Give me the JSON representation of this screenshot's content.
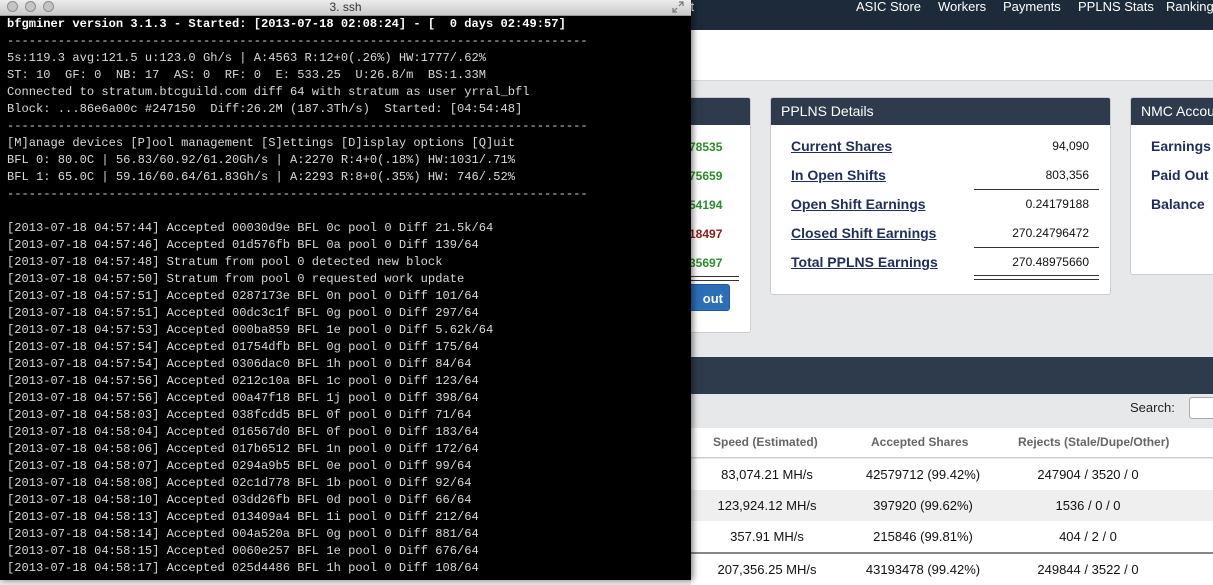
{
  "web": {
    "nav": [
      "ort",
      "ASIC Store",
      "Workers",
      "Payments",
      "PPLNS Stats",
      "Ranking"
    ],
    "left_panel": {
      "values": [
        "78535",
        "75659",
        "54194",
        "18497",
        "35697"
      ],
      "button_label": "out"
    },
    "pplns": {
      "title": "PPLNS Details",
      "rows": [
        {
          "label": "Current Shares",
          "value": "94,090"
        },
        {
          "label": "In Open Shifts",
          "value": "803,356"
        },
        {
          "label": "Open Shift Earnings",
          "value": "0.24179188"
        },
        {
          "label": "Closed Shift Earnings",
          "value": "270.24796472"
        },
        {
          "label": "Total PPLNS Earnings",
          "value": "270.48975660"
        }
      ]
    },
    "nmc": {
      "title": "NMC Accou",
      "links": [
        "Earnings",
        "Paid Out",
        "Balance"
      ]
    },
    "table": {
      "search_label": "Search:",
      "headers": [
        "Speed (Estimated)",
        "Accepted Shares",
        "Rejects (Stale/Dupe/Other)"
      ],
      "rows": [
        [
          "83,074.21 MH/s",
          "42579712 (99.42%)",
          "247904 / 3520 / 0"
        ],
        [
          "123,924.12 MH/s",
          "397920 (99.62%)",
          "1536 / 0 / 0"
        ],
        [
          "357.91 MH/s",
          "215846 (99.81%)",
          "404 / 2 / 0"
        ],
        [
          "207,356.25 MH/s",
          "43193478 (99.42%)",
          "249844 / 3522 / 0"
        ]
      ]
    }
  },
  "terminal": {
    "title": "3. ssh",
    "lines": [
      "bfgminer version 3.1.3 - Started: [2013-07-18 02:08:24] - [  0 days 02:49:57]",
      "--------------------------------------------------------------------------------",
      "5s:119.3 avg:121.5 u:123.0 Gh/s | A:4563 R:12+0(.26%) HW:1777/.62%",
      "ST: 10  GF: 0  NB: 17  AS: 0  RF: 0  E: 533.25  U:26.8/m  BS:1.33M",
      "Connected to stratum.btcguild.com diff 64 with stratum as user yrral_bfl",
      "Block: ...86e6a00c #247150  Diff:26.2M (187.3Th/s)  Started: [04:54:48]",
      "--------------------------------------------------------------------------------",
      "[M]anage devices [P]ool management [S]ettings [D]isplay options [Q]uit",
      "BFL 0: 80.0C | 56.83/60.92/61.20Gh/s | A:2270 R:4+0(.18%) HW:1031/.71%",
      "BFL 1: 65.0C | 59.16/60.64/61.83Gh/s | A:2293 R:8+0(.35%) HW: 746/.52%",
      "--------------------------------------------------------------------------------",
      "",
      "[2013-07-18 04:57:44] Accepted 00030d9e BFL 0c pool 0 Diff 21.5k/64",
      "[2013-07-18 04:57:46] Accepted 01d576fb BFL 0a pool 0 Diff 139/64",
      "[2013-07-18 04:57:48] Stratum from pool 0 detected new block",
      "[2013-07-18 04:57:50] Stratum from pool 0 requested work update",
      "[2013-07-18 04:57:51] Accepted 0287173e BFL 0n pool 0 Diff 101/64",
      "[2013-07-18 04:57:51] Accepted 00dc3c1f BFL 0g pool 0 Diff 297/64",
      "[2013-07-18 04:57:53] Accepted 000ba859 BFL 1e pool 0 Diff 5.62k/64",
      "[2013-07-18 04:57:54] Accepted 01754dfb BFL 0g pool 0 Diff 175/64",
      "[2013-07-18 04:57:54] Accepted 0306dac0 BFL 1h pool 0 Diff 84/64",
      "[2013-07-18 04:57:56] Accepted 0212c10a BFL 1c pool 0 Diff 123/64",
      "[2013-07-18 04:57:56] Accepted 00a47f18 BFL 1j pool 0 Diff 398/64",
      "[2013-07-18 04:58:03] Accepted 038fcdd5 BFL 0f pool 0 Diff 71/64",
      "[2013-07-18 04:58:04] Accepted 016567d0 BFL 0f pool 0 Diff 183/64",
      "[2013-07-18 04:58:06] Accepted 017b6512 BFL 1n pool 0 Diff 172/64",
      "[2013-07-18 04:58:07] Accepted 0294a9b5 BFL 0e pool 0 Diff 99/64",
      "[2013-07-18 04:58:08] Accepted 02c1d778 BFL 1b pool 0 Diff 92/64",
      "[2013-07-18 04:58:10] Accepted 03dd26fb BFL 0d pool 0 Diff 66/64",
      "[2013-07-18 04:58:13] Accepted 013409a4 BFL 1i pool 0 Diff 212/64",
      "[2013-07-18 04:58:14] Accepted 004a520a BFL 0g pool 0 Diff 881/64",
      "[2013-07-18 04:58:15] Accepted 0060e257 BFL 1e pool 0 Diff 676/64",
      "[2013-07-18 04:58:17] Accepted 025d4486 BFL 1h pool 0 Diff 108/64"
    ]
  }
}
